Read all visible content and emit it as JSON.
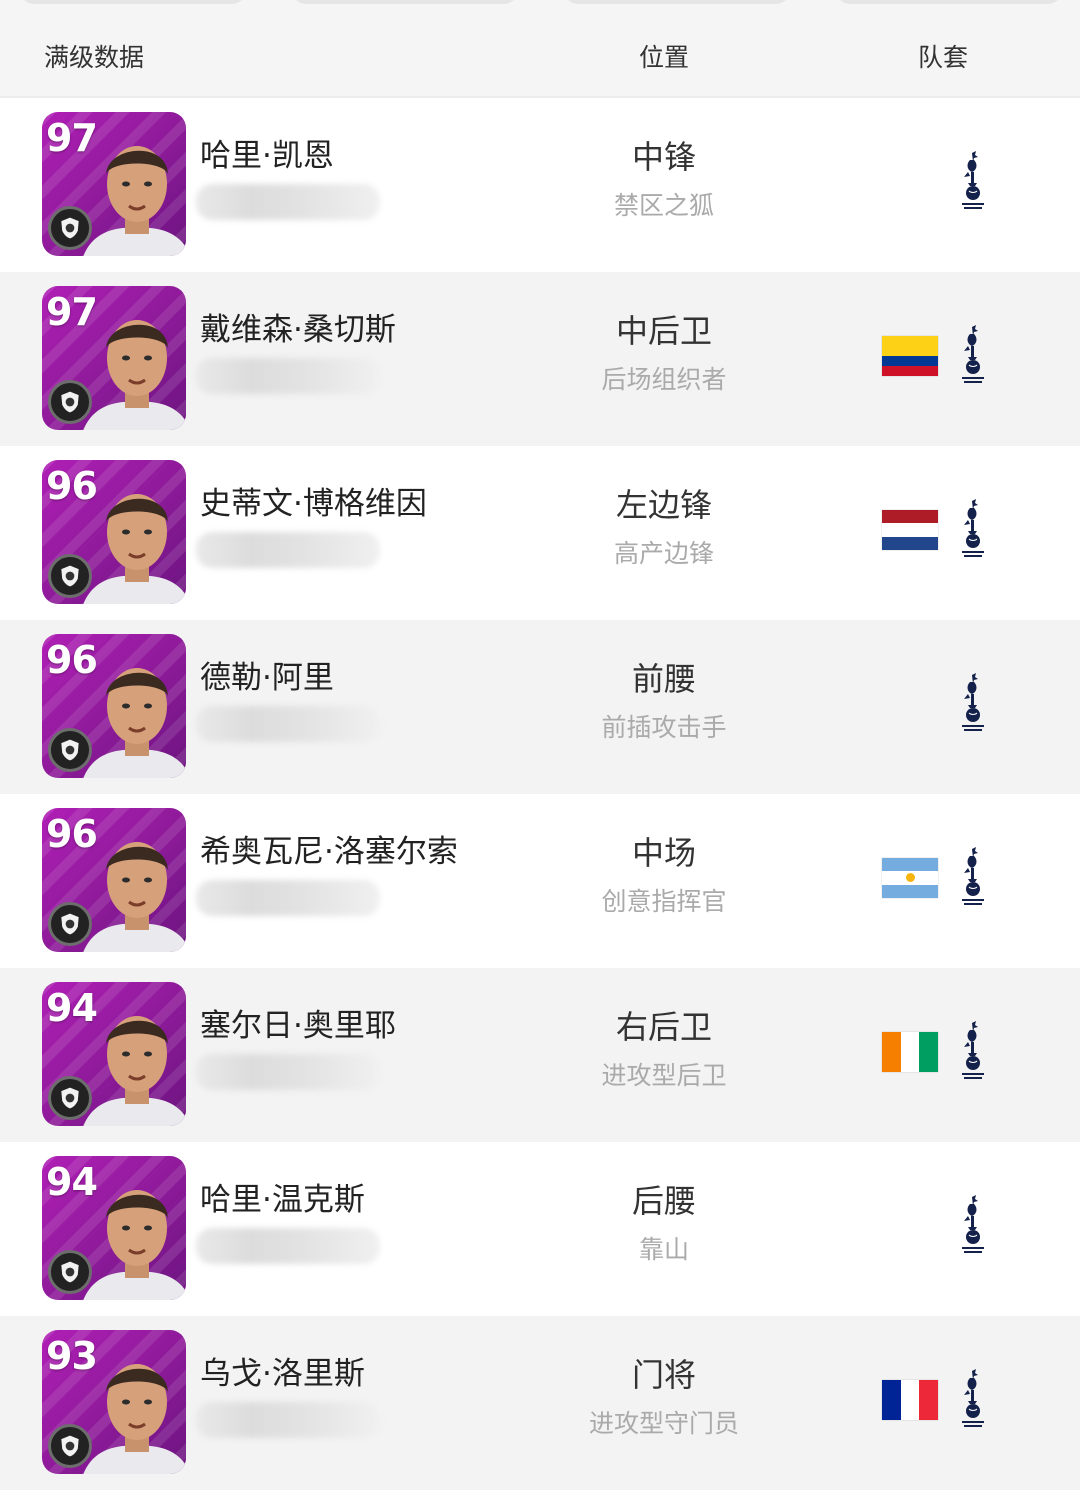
{
  "header": {
    "data_label": "满级数据",
    "position_label": "位置",
    "kit_label": "队套"
  },
  "colors": {
    "card_purple": "#a61cab",
    "spurs_navy": "#14214a"
  },
  "players": [
    {
      "rating": "97",
      "name": "哈里·凯恩",
      "position": "中锋",
      "style": "禁区之狐",
      "flag": null,
      "club_icon": "spurs-crest-icon"
    },
    {
      "rating": "97",
      "name": "戴维森·桑切斯",
      "position": "中后卫",
      "style": "后场组织者",
      "flag": {
        "name": "colombia-flag-icon",
        "layout": "h",
        "colors": [
          "#fcd116",
          "#fcd116",
          "#003893",
          "#ce1126"
        ]
      },
      "club_icon": "spurs-crest-icon"
    },
    {
      "rating": "96",
      "name": "史蒂文·博格维因",
      "position": "左边锋",
      "style": "高产边锋",
      "flag": {
        "name": "netherlands-flag-icon",
        "layout": "h",
        "colors": [
          "#ae1c28",
          "#ffffff",
          "#21468b"
        ]
      },
      "club_icon": "spurs-crest-icon"
    },
    {
      "rating": "96",
      "name": "德勒·阿里",
      "position": "前腰",
      "style": "前插攻击手",
      "flag": null,
      "club_icon": "spurs-crest-icon"
    },
    {
      "rating": "96",
      "name": "希奥瓦尼·洛塞尔索",
      "position": "中场",
      "style": "创意指挥官",
      "flag": {
        "name": "argentina-flag-icon",
        "layout": "h",
        "colors": [
          "#74acdf",
          "#ffffff",
          "#74acdf"
        ]
      },
      "club_icon": "spurs-crest-icon"
    },
    {
      "rating": "94",
      "name": "塞尔日·奥里耶",
      "position": "右后卫",
      "style": "进攻型后卫",
      "flag": {
        "name": "ivory-coast-flag-icon",
        "layout": "v",
        "colors": [
          "#f77f00",
          "#ffffff",
          "#009e60"
        ]
      },
      "club_icon": "spurs-crest-icon"
    },
    {
      "rating": "94",
      "name": "哈里·温克斯",
      "position": "后腰",
      "style": "靠山",
      "flag": null,
      "club_icon": "spurs-crest-icon"
    },
    {
      "rating": "93",
      "name": "乌戈·洛里斯",
      "position": "门将",
      "style": "进攻型守门员",
      "flag": {
        "name": "france-flag-icon",
        "layout": "v",
        "colors": [
          "#002395",
          "#ffffff",
          "#ed2939"
        ]
      },
      "club_icon": "spurs-crest-icon"
    }
  ]
}
